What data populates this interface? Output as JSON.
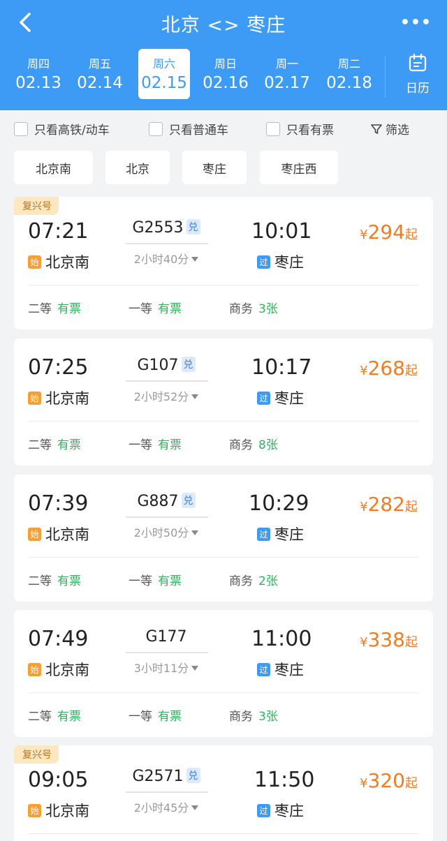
{
  "header": {
    "title": "北京 <> 枣庄",
    "more": "•••",
    "calendar_label": "日历",
    "dates": [
      {
        "weekday": "周四",
        "date": "02.13",
        "active": false
      },
      {
        "weekday": "周五",
        "date": "02.14",
        "active": false
      },
      {
        "weekday": "周六",
        "date": "02.15",
        "active": true
      },
      {
        "weekday": "周日",
        "date": "02.16",
        "active": false
      },
      {
        "weekday": "周一",
        "date": "02.17",
        "active": false
      },
      {
        "weekday": "周二",
        "date": "02.18",
        "active": false
      }
    ]
  },
  "filters": {
    "high_speed": "只看高铁/动车",
    "regular": "只看普通车",
    "available": "只看有票",
    "filter": "筛选"
  },
  "stations": [
    "北京南",
    "北京",
    "枣庄",
    "枣庄西"
  ],
  "trains": [
    {
      "tag": "复兴号",
      "dep_time": "07:21",
      "dep_station": "北京南",
      "dep_badge": "始",
      "train_no": "G2553",
      "exchange": "兑",
      "duration": "2小时40分",
      "arr_time": "10:01",
      "arr_station": "枣庄",
      "arr_badge": "过",
      "price_symbol": "¥",
      "price": "294",
      "price_suffix": "起",
      "seats": [
        {
          "name": "二等",
          "status": "有票"
        },
        {
          "name": "一等",
          "status": "有票"
        },
        {
          "name": "商务",
          "status": "3张"
        }
      ]
    },
    {
      "tag": "",
      "dep_time": "07:25",
      "dep_station": "北京南",
      "dep_badge": "始",
      "train_no": "G107",
      "exchange": "兑",
      "duration": "2小时52分",
      "arr_time": "10:17",
      "arr_station": "枣庄",
      "arr_badge": "过",
      "price_symbol": "¥",
      "price": "268",
      "price_suffix": "起",
      "seats": [
        {
          "name": "二等",
          "status": "有票"
        },
        {
          "name": "一等",
          "status": "有票"
        },
        {
          "name": "商务",
          "status": "8张"
        }
      ]
    },
    {
      "tag": "",
      "dep_time": "07:39",
      "dep_station": "北京南",
      "dep_badge": "始",
      "train_no": "G887",
      "exchange": "兑",
      "duration": "2小时50分",
      "arr_time": "10:29",
      "arr_station": "枣庄",
      "arr_badge": "过",
      "price_symbol": "¥",
      "price": "282",
      "price_suffix": "起",
      "seats": [
        {
          "name": "二等",
          "status": "有票"
        },
        {
          "name": "一等",
          "status": "有票"
        },
        {
          "name": "商务",
          "status": "2张"
        }
      ]
    },
    {
      "tag": "",
      "dep_time": "07:49",
      "dep_station": "北京南",
      "dep_badge": "始",
      "train_no": "G177",
      "exchange": "",
      "duration": "3小时11分",
      "arr_time": "11:00",
      "arr_station": "枣庄",
      "arr_badge": "过",
      "price_symbol": "¥",
      "price": "338",
      "price_suffix": "起",
      "seats": [
        {
          "name": "二等",
          "status": "有票"
        },
        {
          "name": "一等",
          "status": "有票"
        },
        {
          "name": "商务",
          "status": "3张"
        }
      ]
    },
    {
      "tag": "复兴号",
      "dep_time": "09:05",
      "dep_station": "北京南",
      "dep_badge": "始",
      "train_no": "G2571",
      "exchange": "兑",
      "duration": "2小时45分",
      "arr_time": "11:50",
      "arr_station": "枣庄",
      "arr_badge": "过",
      "price_symbol": "¥",
      "price": "320",
      "price_suffix": "起",
      "seats": []
    }
  ]
}
